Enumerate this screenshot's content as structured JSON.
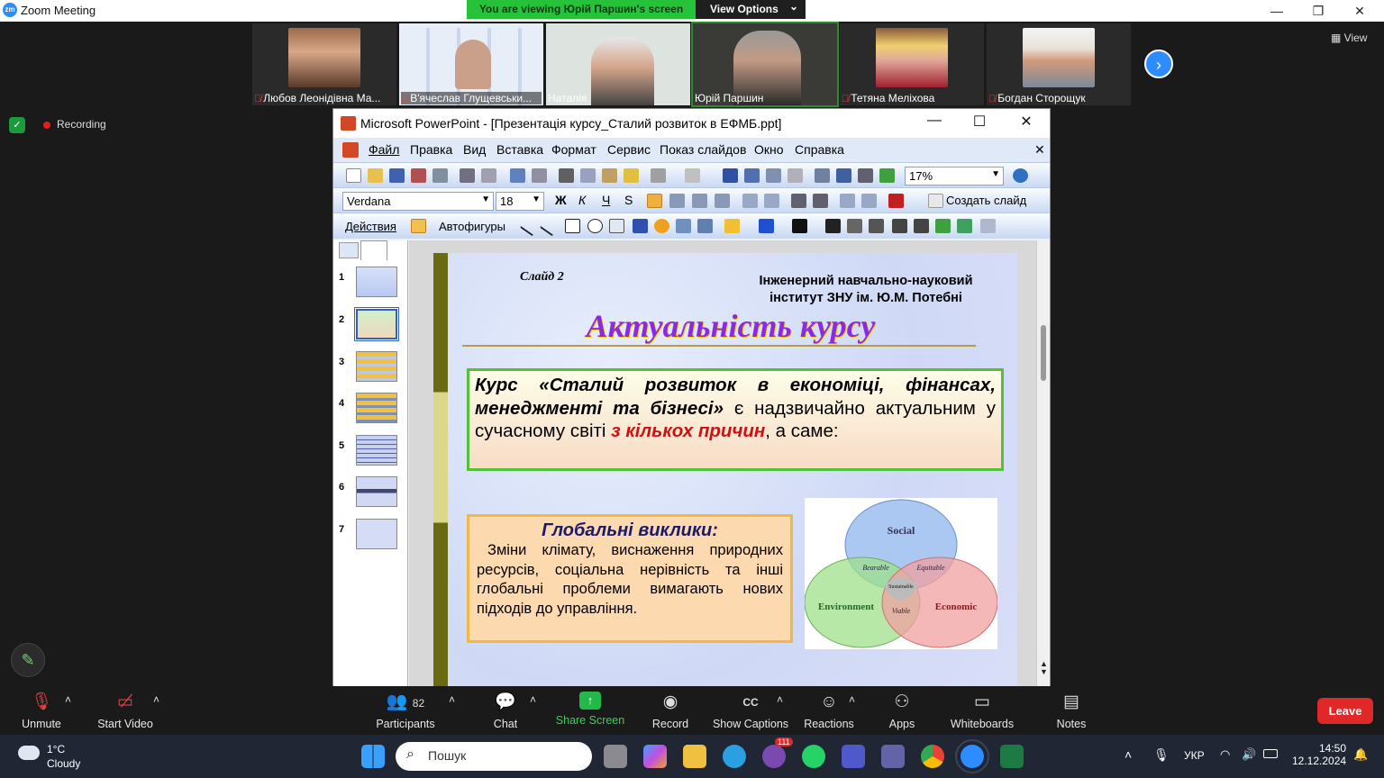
{
  "window": {
    "title": "Zoom Meeting",
    "minimize": "—",
    "restore": "❐",
    "close": "✕"
  },
  "share_banner": {
    "viewing": "You are viewing Юрій Паршин's screen",
    "view_options": "View Options",
    "chevron": "⌄"
  },
  "participants": [
    {
      "name": "Любов Леонідівна Ма...",
      "muted": true
    },
    {
      "name": "В'ячеслав Глущевськи...",
      "muted": true
    },
    {
      "name": "Наталія",
      "muted": false
    },
    {
      "name": "Юрій Паршин",
      "muted": false
    },
    {
      "name": "Тетяна Меліхова",
      "muted": true
    },
    {
      "name": "Богдан Сторощук",
      "muted": true
    }
  ],
  "view_button": "View",
  "recording": {
    "label": "Recording"
  },
  "ppt": {
    "title": "Microsoft PowerPoint - [Презентація курсу_Сталий розвиток в ЕФМБ.ppt]",
    "menu": [
      "Файл",
      "Правка",
      "Вид",
      "Вставка",
      "Формат",
      "Сервис",
      "Показ слайдов",
      "Окно",
      "Справка"
    ],
    "zoom": "17%",
    "font": "Verdana",
    "font_size": "18",
    "create_slide": "Создать слайд",
    "actions": "Действия",
    "autoshapes": "Автофигуры",
    "slide_numbers": [
      "1",
      "2",
      "3",
      "4",
      "5",
      "6",
      "7"
    ]
  },
  "slide": {
    "label": "Слайд 2",
    "institute_line1": "Інженерний навчально-науковий",
    "institute_line2": "інститут ЗНУ ім. Ю.М. Потебні",
    "title": "Актуальність курсу",
    "box1_bold": "Курс «Сталий розвиток в економіці, фінансах, менеджменті та бізнесі»",
    "box1_text": " є надзвичайно актуальним у сучасному світі ",
    "box1_red": "з кількох причин",
    "box1_end": ", а саме:",
    "box2_title": "Глобальні виклики",
    "box2_colon": ":",
    "box2_text": "Зміни клімату, виснаження природних ресурсів, соціальна нерівність та інші глобальні проблеми вимагають нових підходів до управління.",
    "venn": {
      "social": "Social",
      "environment": "Environment",
      "economic": "Economic",
      "bearable": "Bearable",
      "equitable": "Equitable",
      "viable": "Viable",
      "sustainable": "Sustainable"
    }
  },
  "bottombar": {
    "unmute": "Unmute",
    "start_video": "Start Video",
    "participants": "Participants",
    "participants_count": "82",
    "chat": "Chat",
    "share": "Share Screen",
    "record": "Record",
    "captions": "Show Captions",
    "reactions": "Reactions",
    "apps": "Apps",
    "whiteboards": "Whiteboards",
    "notes": "Notes",
    "leave": "Leave"
  },
  "taskbar": {
    "weather_temp": "1°C",
    "weather_desc": "Cloudy",
    "search": "Пошук",
    "lang": "УКР",
    "time": "14:50",
    "date": "12.12.2024",
    "viber_badge": "111"
  }
}
